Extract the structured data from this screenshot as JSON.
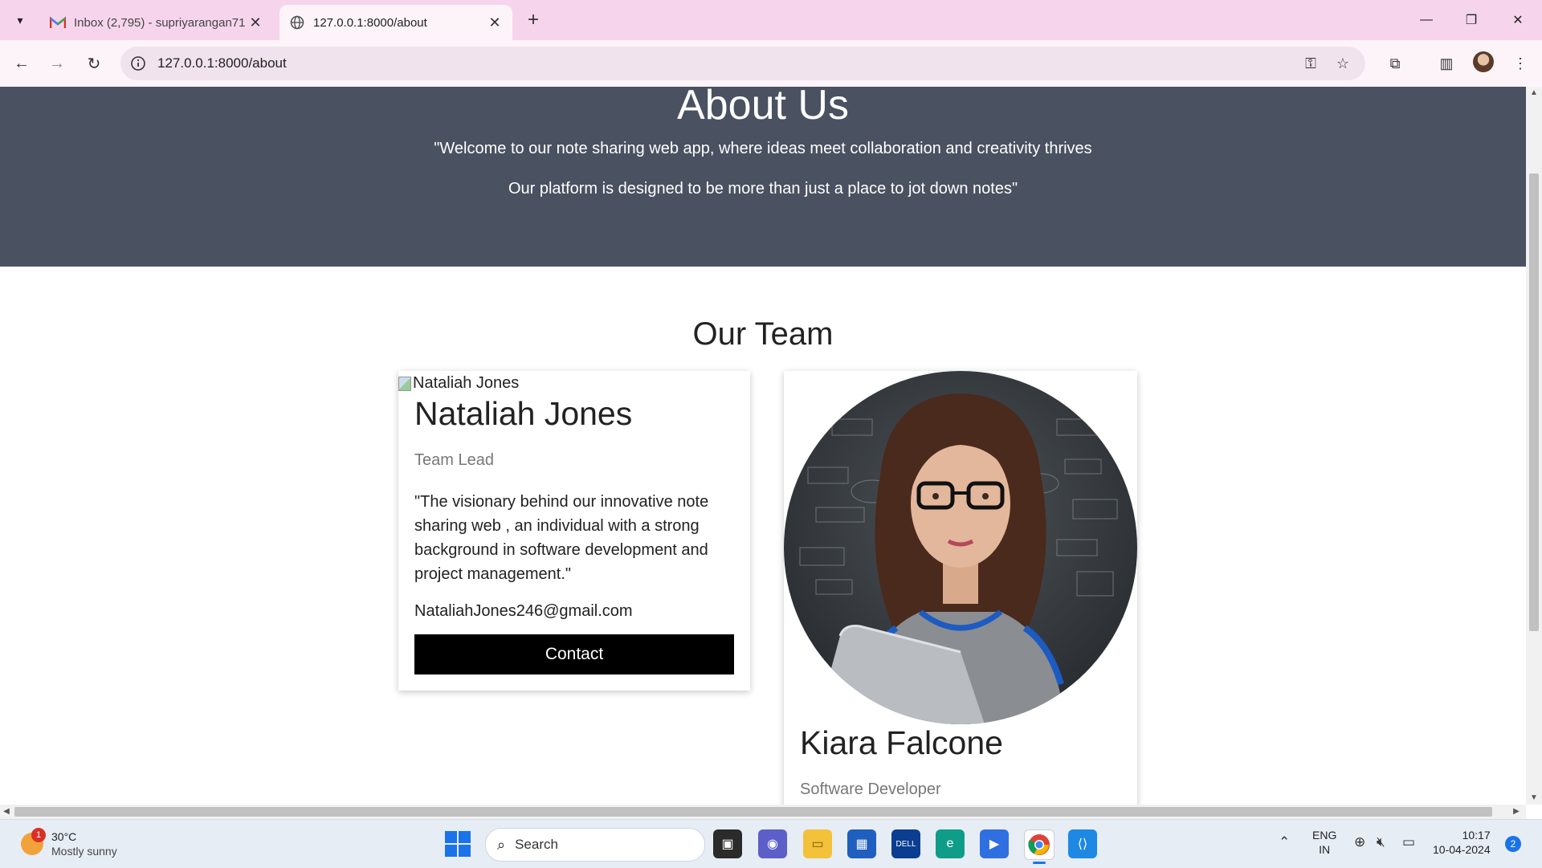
{
  "browser": {
    "tabs": [
      {
        "title": "Inbox (2,795) - supriyarangan71",
        "active": false
      },
      {
        "title": "127.0.0.1:8000/about",
        "active": true
      }
    ],
    "url": "127.0.0.1:8000/about"
  },
  "page": {
    "hero": {
      "title": "About Us",
      "line1": "\"Welcome to our note sharing web app, where ideas meet collaboration and creativity thrives",
      "line2": "Our platform is designed to be more than just a place to jot down notes\""
    },
    "team_title": "Our Team",
    "members": [
      {
        "img_alt": "Nataliah Jones",
        "name": "Nataliah Jones",
        "role": "Team Lead",
        "quote": "\"The visionary behind our innovative note sharing web , an individual with a strong background in software development and project management.\"",
        "email": "NataliahJones246@gmail.com",
        "contact_label": "Contact"
      },
      {
        "name": "Kiara Falcone",
        "role": "Software Developer"
      }
    ]
  },
  "taskbar": {
    "weather": {
      "temp": "30°C",
      "condition": "Mostly sunny",
      "badge": "1"
    },
    "search_placeholder": "Search",
    "lang": "ENG",
    "region": "IN",
    "time": "10:17",
    "date": "10-04-2024",
    "notifications": "2"
  },
  "colors": {
    "hero_bg": "#4a5161",
    "tab_strip": "#f6d5ec",
    "button_bg": "#000000"
  }
}
